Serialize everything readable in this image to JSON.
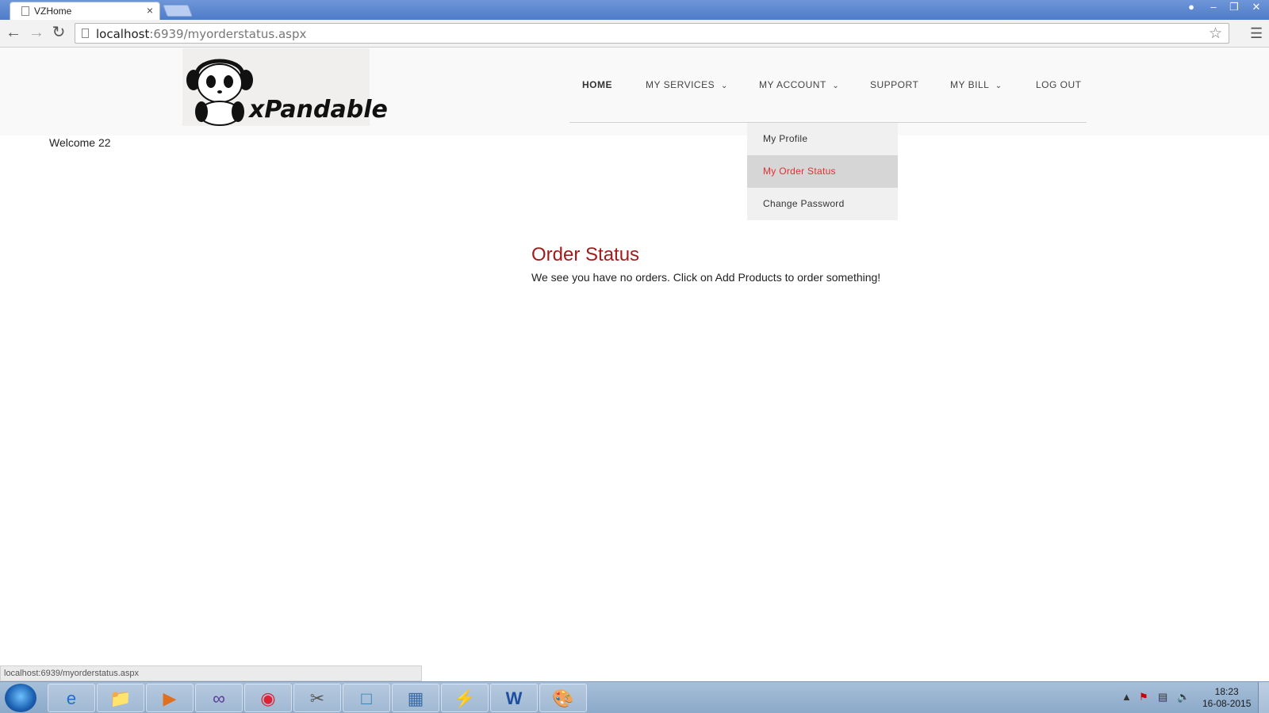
{
  "browser": {
    "tab_title": "VZHome",
    "tab_close": "×",
    "url_host": "localhost",
    "url_path": ":6939/myorderstatus.aspx",
    "status_url": "localhost:6939/myorderstatus.aspx"
  },
  "site": {
    "logo_text": "xPandable",
    "nav": {
      "home": "HOME",
      "services": "MY SERVICES",
      "account": "MY ACCOUNT",
      "support": "SUPPORT",
      "bill": "MY BILL",
      "logout": "LOG OUT",
      "chevron": "⌄"
    },
    "account_menu": [
      "My Profile",
      "My Order Status",
      "Change Password"
    ],
    "welcome": "Welcome 22",
    "order_title": "Order Status",
    "order_message": "We see you have no orders. Click on Add Products to order something!"
  },
  "taskbar": {
    "time": "18:23",
    "date": "16-08-2015"
  },
  "colors": {
    "accent_red": "#a11c1c",
    "active_menu": "#e03030"
  }
}
